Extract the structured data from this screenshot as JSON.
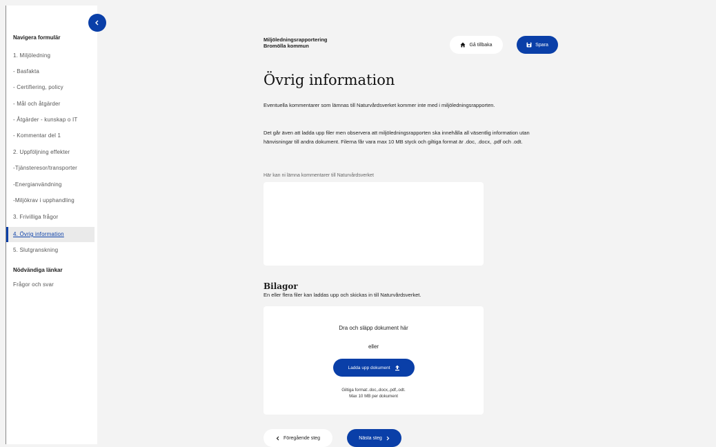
{
  "sidebar": {
    "heading": "Navigera formulär",
    "items": [
      {
        "label": "1. Miljöledning"
      },
      {
        "label": "- Basfakta"
      },
      {
        "label": "- Certifiering, policy"
      },
      {
        "label": "- Mål och åtgärder"
      },
      {
        "label": "- Åtgärder - kunskap o IT"
      },
      {
        "label": "- Kommentar del 1"
      },
      {
        "label": "2. Uppföljning effekter"
      },
      {
        "label": "-Tjänsteresor/transporter"
      },
      {
        "label": "-Energianvändning"
      },
      {
        "label": "-Miljökrav i upphandling"
      },
      {
        "label": "3. Frivilliga frågor"
      },
      {
        "label": "4. Övrig information",
        "active": true
      },
      {
        "label": "5. Slutgranskning"
      }
    ],
    "links_heading": "Nödvändiga länkar",
    "links": [
      {
        "label": "Frågor och svar"
      }
    ]
  },
  "header": {
    "report": "Miljöledningsrapportering",
    "municipality": "Bromölla kommun",
    "back_label": "Gå tillbaka",
    "save_label": "Spara"
  },
  "main": {
    "title": "Övrig information",
    "intro": "Eventuella kommentarer som lämnas till Naturvårdsverket kommer inte med i miljöledningsrapporten.",
    "files_info": "Det går även att ladda upp filer men observera att miljöledningsrapporten ska innehålla all väsentlig information utan hänvisningar till andra dokument. Filerna får vara max 10 MB styck och giltiga format är .doc, .docx, .pdf och .odt.",
    "comment_label": "Här kan ni lämna kommentarer till Naturvårdsverket",
    "comment_value": ""
  },
  "attachments": {
    "title": "Bilagor",
    "description": "En eller flera filer kan laddas upp och skickas in till Naturvårdsverket.",
    "drop_text": "Dra och släpp dokument här",
    "or_text": "eller",
    "upload_label": "Ladda upp dokument",
    "formats": "Giltiga format:.doc,.docx,.pdf,.odt.",
    "max_size": "Max 10 MB per dokument"
  },
  "footer": {
    "prev_label": "Föregående steg",
    "next_label": "Nästa steg"
  },
  "colors": {
    "accent": "#0a3fa8",
    "background": "#f3f3f3"
  }
}
